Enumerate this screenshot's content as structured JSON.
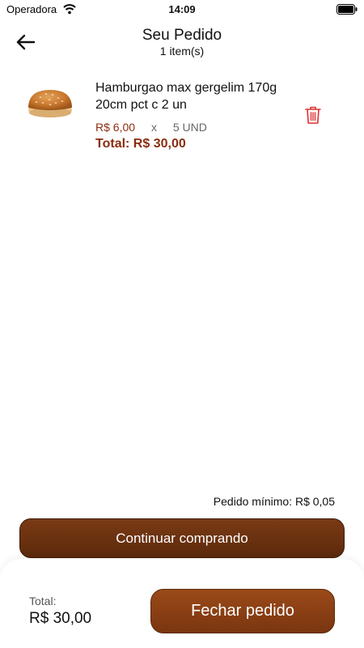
{
  "status_bar": {
    "carrier": "Operadora",
    "time": "14:09"
  },
  "header": {
    "title": "Seu Pedido",
    "subtitle": "1 item(s)"
  },
  "items": [
    {
      "name": "Hamburgao max  gergelim 170g 20cm pct c 2 un",
      "unit_price": "R$ 6,00",
      "times": "x",
      "quantity": "5 UND",
      "total": "Total: R$ 30,00"
    }
  ],
  "minimum_order": "Pedido mínimo: R$ 0,05",
  "continue_button_label": "Continuar comprando",
  "footer": {
    "total_label": "Total:",
    "total_value": "R$ 30,00",
    "checkout_label": "Fechar pedido"
  },
  "colors": {
    "accent": "#8a2d10",
    "button_brown": "#6b3210",
    "delete_red": "#e03030"
  },
  "icons": [
    "wifi-icon",
    "battery-icon",
    "back-arrow-icon",
    "trash-icon"
  ]
}
